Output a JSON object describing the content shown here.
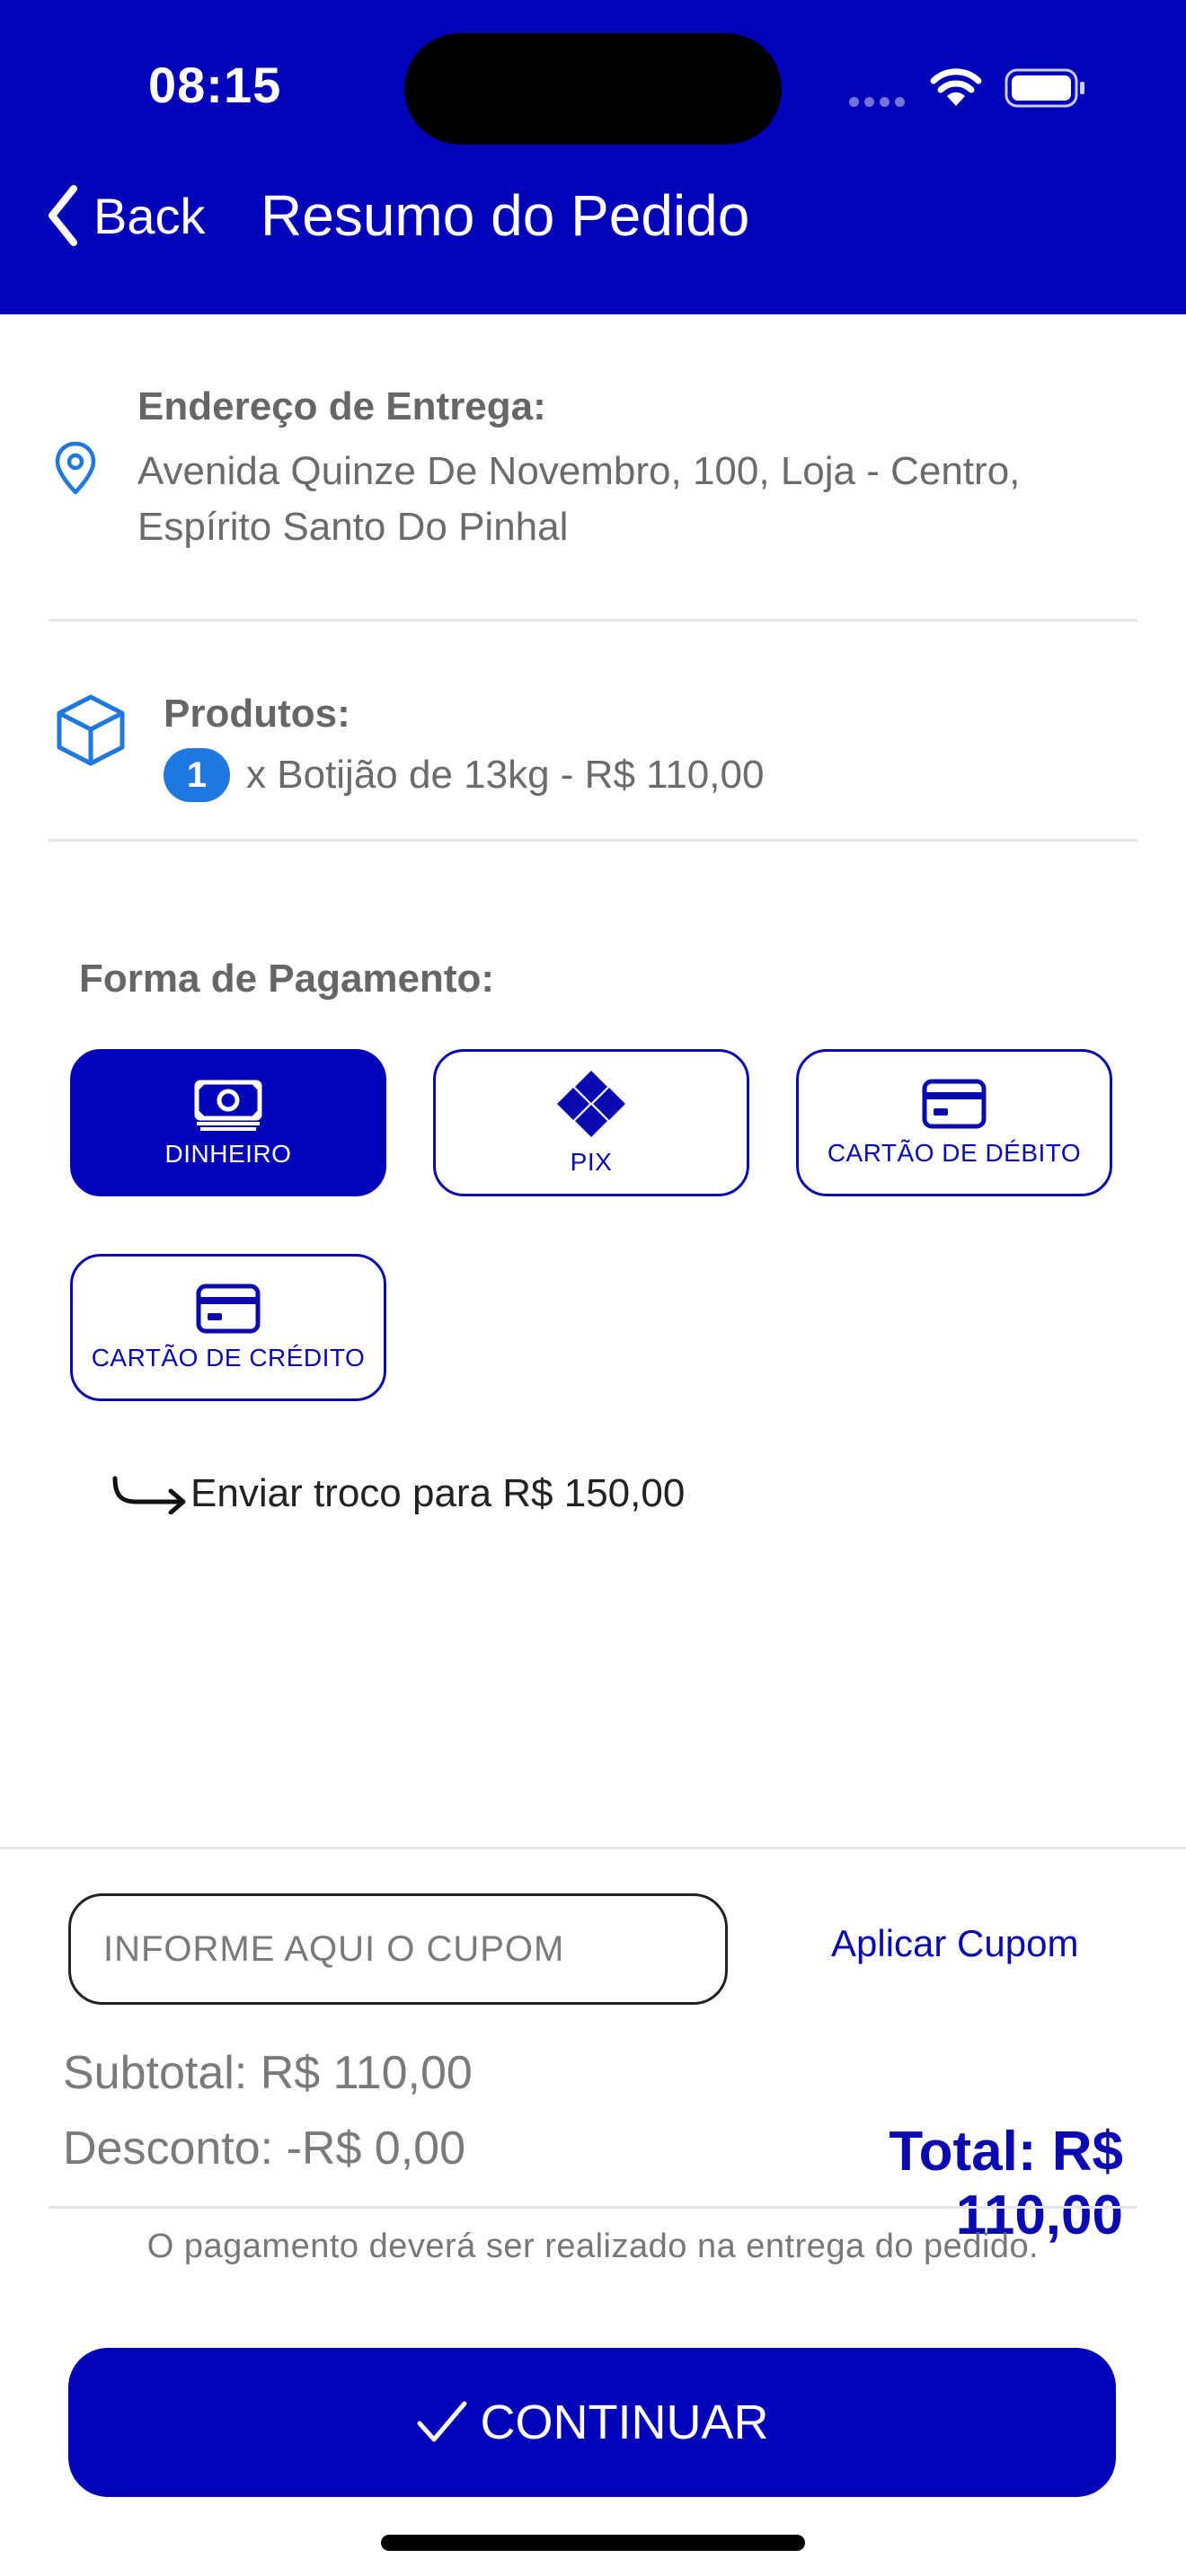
{
  "status_bar": {
    "time": "08:15"
  },
  "header": {
    "back_label": "Back",
    "title": "Resumo do Pedido"
  },
  "address": {
    "title": "Endereço de Entrega:",
    "line1": "Avenida Quinze De Novembro, 100, Loja - Centro,",
    "line2": "Espírito Santo Do Pinhal"
  },
  "products": {
    "title": "Produtos:",
    "items": [
      {
        "quantity": "1",
        "description": "x Botijão de 13kg - R$ 110,00"
      }
    ]
  },
  "payment": {
    "title": "Forma de Pagamento:",
    "options": [
      {
        "label": "DINHEIRO",
        "selected": true,
        "icon": "cash-icon"
      },
      {
        "label": "PIX",
        "selected": false,
        "icon": "pix-icon"
      },
      {
        "label": "CARTÃO DE DÉBITO",
        "selected": false,
        "icon": "card-icon"
      },
      {
        "label": "CARTÃO DE CRÉDITO",
        "selected": false,
        "icon": "card-icon"
      }
    ],
    "change_text": "Enviar troco para R$ 150,00"
  },
  "coupon": {
    "placeholder": "INFORME AQUI O CUPOM",
    "value": "",
    "apply_label": "Aplicar Cupom"
  },
  "summary": {
    "subtotal": "Subtotal: R$ 110,00",
    "discount": "Desconto: -R$ 0,00",
    "total": "Total: R$ 110,00",
    "note": "O pagamento deverá ser realizado na entrega do pedido."
  },
  "continue_label": "CONTINUAR",
  "colors": {
    "primary": "#0202b8",
    "badge": "#1e78e0",
    "icon_blue": "#1e78e0"
  }
}
